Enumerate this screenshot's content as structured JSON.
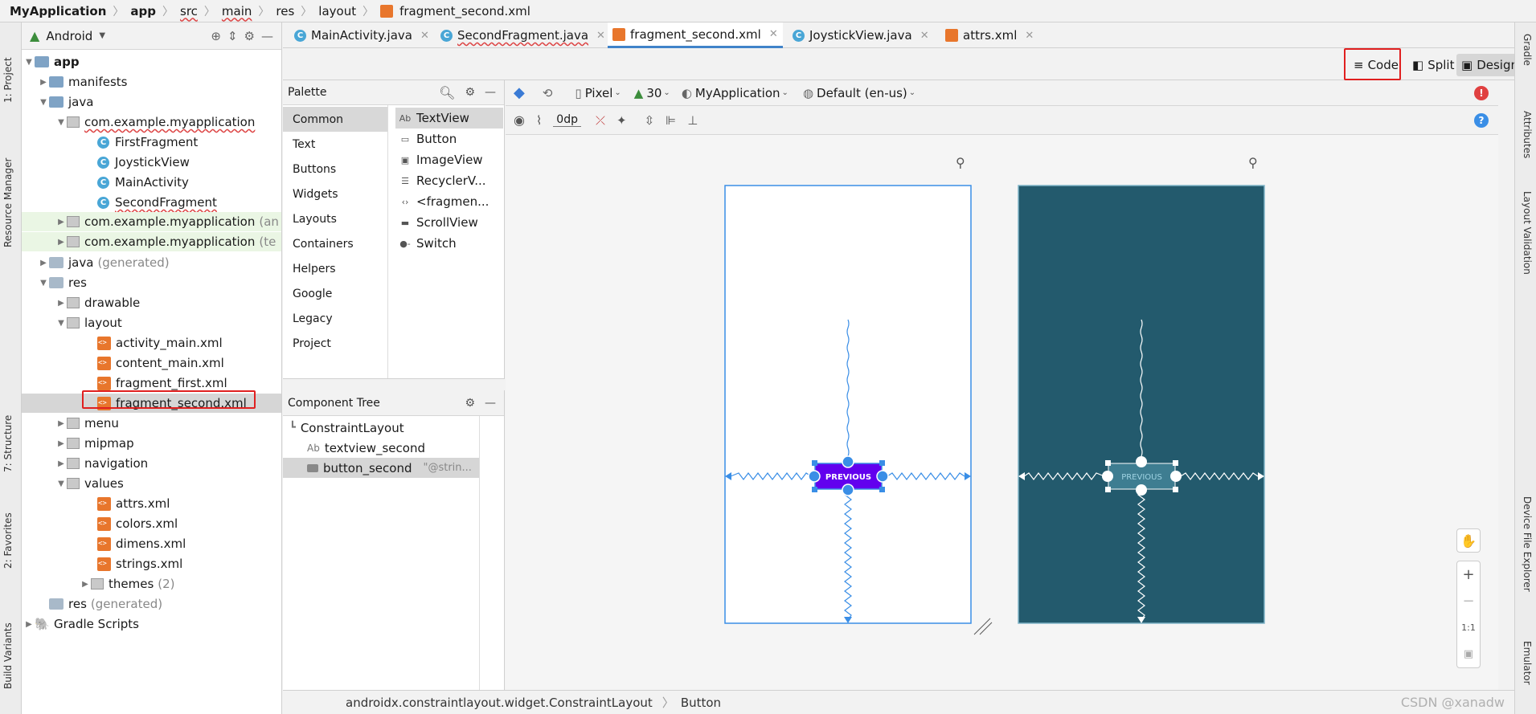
{
  "breadcrumb": [
    "MyApplication",
    "app",
    "src",
    "main",
    "res",
    "layout",
    "fragment_second.xml"
  ],
  "project_toolbar": {
    "view": "Android"
  },
  "left_strip": {
    "project": "1: Project",
    "resource_manager": "Resource Manager",
    "structure": "7: Structure",
    "favorites": "2: Favorites",
    "build_variants": "Build Variants"
  },
  "right_strip": {
    "gradle": "Gradle",
    "attributes": "Attributes",
    "layout_validation": "Layout Validation",
    "device_file_explorer": "Device File Explorer",
    "emulator": "Emulator"
  },
  "tree": {
    "app": "app",
    "manifests": "manifests",
    "java": "java",
    "pkg_main": "com.example.myapplication",
    "first_fragment": "FirstFragment",
    "joystick_view": "JoystickView",
    "main_activity": "MainActivity",
    "second_fragment": "SecondFragment",
    "pkg_android_test": "com.example.myapplication",
    "pkg_android_test_suffix": "(an",
    "pkg_test": "com.example.myapplication",
    "pkg_test_suffix": "(te",
    "java_generated": "java",
    "java_generated_suffix": "(generated)",
    "res": "res",
    "drawable": "drawable",
    "layout": "layout",
    "activity_main": "activity_main.xml",
    "content_main": "content_main.xml",
    "fragment_first": "fragment_first.xml",
    "fragment_second": "fragment_second.xml",
    "menu": "menu",
    "mipmap": "mipmap",
    "navigation": "navigation",
    "values": "values",
    "attrs": "attrs.xml",
    "colors": "colors.xml",
    "dimens": "dimens.xml",
    "strings": "strings.xml",
    "themes": "themes",
    "themes_count": "(2)",
    "res_generated": "res",
    "res_generated_suffix": "(generated)",
    "gradle_scripts": "Gradle Scripts"
  },
  "tabs": [
    "MainActivity.java",
    "SecondFragment.java",
    "fragment_second.xml",
    "JoystickView.java",
    "attrs.xml"
  ],
  "modes": {
    "code": "Code",
    "split": "Split",
    "design": "Design"
  },
  "palette": {
    "title": "Palette",
    "categories": [
      "Common",
      "Text",
      "Buttons",
      "Widgets",
      "Layouts",
      "Containers",
      "Helpers",
      "Google",
      "Legacy",
      "Project"
    ],
    "items": [
      "TextView",
      "Button",
      "ImageView",
      "RecyclerV...",
      "<fragmen...",
      "ScrollView",
      "Switch"
    ]
  },
  "component_tree": {
    "title": "Component Tree",
    "root": "ConstraintLayout",
    "textview": "textview_second",
    "button": "button_second",
    "button_hint": "\"@strin..."
  },
  "design_toolbar": {
    "device": "Pixel",
    "api": "30",
    "theme": "MyApplication",
    "locale": "Default (en-us)",
    "margin": "0dp"
  },
  "preview": {
    "button_label": "PREVIOUS"
  },
  "zoom": {
    "plus": "+",
    "minus": "−",
    "one_to_one": "1:1"
  },
  "status": {
    "path": "androidx.constraintlayout.widget.ConstraintLayout",
    "component": "Button"
  },
  "watermark": "CSDN @xanadw",
  "colors": {
    "accent": "#4083c9",
    "blueprint": "#235a6d",
    "button": "#6200ee",
    "highlight": "#e02020"
  }
}
